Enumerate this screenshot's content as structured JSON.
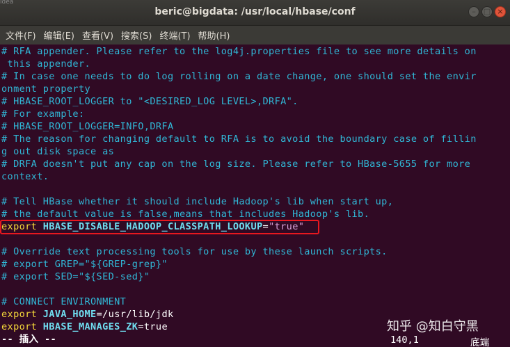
{
  "window": {
    "title": "beric@bigdata: /usr/local/hbase/conf",
    "background_tab_text": "idea",
    "buttons": {
      "minimize": "–",
      "maximize": "□",
      "close": "×"
    }
  },
  "menu": {
    "items": [
      "文件(F)",
      "编辑(E)",
      "查看(V)",
      "搜索(S)",
      "终端(T)",
      "帮助(H)"
    ]
  },
  "terminal": {
    "lines": [
      "# RFA appender. Please refer to the log4j.properties file to see more details on",
      " this appender.",
      "# In case one needs to do log rolling on a date change, one should set the envir",
      "onment property",
      "# HBASE_ROOT_LOGGER to \"<DESIRED_LOG LEVEL>,DRFA\".",
      "# For example:",
      "# HBASE_ROOT_LOGGER=INFO,DRFA",
      "# The reason for changing default to RFA is to avoid the boundary case of fillin",
      "g out disk space as",
      "# DRFA doesn't put any cap on the log size. Please refer to HBase-5655 for more",
      "context.",
      "",
      "# Tell HBase whether it should include Hadoop's lib when start up,",
      "# the default value is false,means that includes Hadoop's lib."
    ],
    "export1": {
      "keyword": "export",
      "name": "HBASE_DISABLE_HADOOP_CLASSPATH_LOOKUP",
      "equals": "=",
      "value": "\"true\""
    },
    "lines2": [
      "",
      "# Override text processing tools for use by these launch scripts.",
      "# export GREP=\"${GREP-grep}\"",
      "# export SED=\"${SED-sed}\"",
      "",
      "# CONNECT ENVIRONMENT"
    ],
    "export2": {
      "keyword": "export",
      "name": "JAVA_HOME",
      "equals": "=",
      "value": "/usr/lib/jdk"
    },
    "export3": {
      "keyword": "export",
      "name": "HBASE_MANAGES_ZK",
      "equals": "=",
      "value": "true"
    },
    "mode_line": "-- 插入 --",
    "cursor_position": "140,1",
    "scroll_position": "底端"
  },
  "watermark": "知乎 @知白守黑",
  "colors": {
    "terminal_bg": "#300a24",
    "comment": "#30b7d6",
    "keyword": "#f5d93a",
    "highlight_border": "#e8181f"
  }
}
